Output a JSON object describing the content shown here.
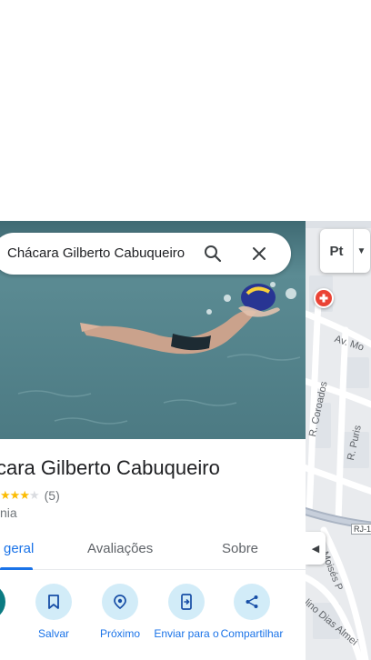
{
  "search": {
    "query": "Chácara Gilberto Cabuqueiro"
  },
  "place": {
    "title": "Chácara Gilberto Cabuqueiro",
    "title_visible": "cara Gilberto Cabuqueiro",
    "rating_stars": 4,
    "review_count": "(5)",
    "category": "nia"
  },
  "tabs": [
    {
      "label": "geral",
      "active": true
    },
    {
      "label": "Avaliações",
      "active": false
    },
    {
      "label": "Sobre",
      "active": false
    }
  ],
  "actions": [
    {
      "label": "s",
      "icon": "directions-icon"
    },
    {
      "label": "Salvar",
      "icon": "bookmark-icon"
    },
    {
      "label": "Próximo",
      "icon": "nearby-icon"
    },
    {
      "label": "Enviar para o",
      "icon": "send-to-phone-icon"
    },
    {
      "label": "Compartilhar",
      "icon": "share-icon"
    }
  ],
  "map": {
    "layers_label": "Pt",
    "streets": [
      "Av. Mo",
      "R. Coroados",
      "R. Puris",
      "RJ-1",
      "Moisés P",
      "lino Dias Almei"
    ]
  },
  "colors": {
    "accent": "#1a73e8",
    "star": "#fbbc04",
    "action_circle": "#d2ecf8",
    "directions_circle": "#0b7b82",
    "hospital_pin": "#ea4335"
  }
}
